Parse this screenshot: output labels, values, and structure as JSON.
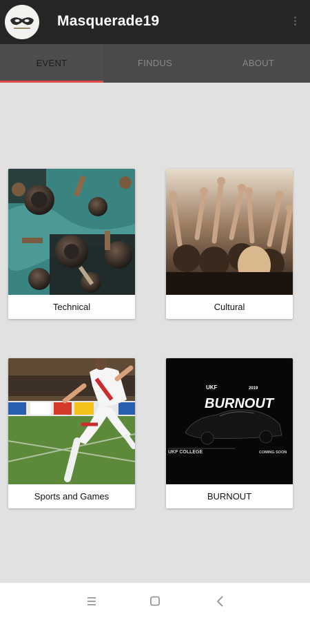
{
  "app": {
    "title": "Masquerade19"
  },
  "tabs": [
    {
      "label": "EVENT",
      "active": true
    },
    {
      "label": "FINDUS",
      "active": false
    },
    {
      "label": "ABOUT",
      "active": false
    }
  ],
  "colors": {
    "appbar": "#262626",
    "tabbar": "#4a4a4a",
    "accent": "#e04a4a",
    "background": "#e1e1e1"
  },
  "cards": [
    {
      "label": "Technical",
      "image": "machinery-photo"
    },
    {
      "label": "Cultural",
      "image": "concert-crowd-photo"
    },
    {
      "label": "Sports and Games",
      "image": "football-player-photo"
    },
    {
      "label": "BURNOUT",
      "image": "burnout-poster",
      "poster": {
        "brand_small": "UKF",
        "headline": "BURNOUT",
        "year": "2019",
        "college": "UKF COLLEGE",
        "status": "COMING SOON"
      }
    }
  ],
  "system_nav": {
    "icons": [
      "menu-icon",
      "home-square-icon",
      "back-chevron-icon"
    ]
  }
}
